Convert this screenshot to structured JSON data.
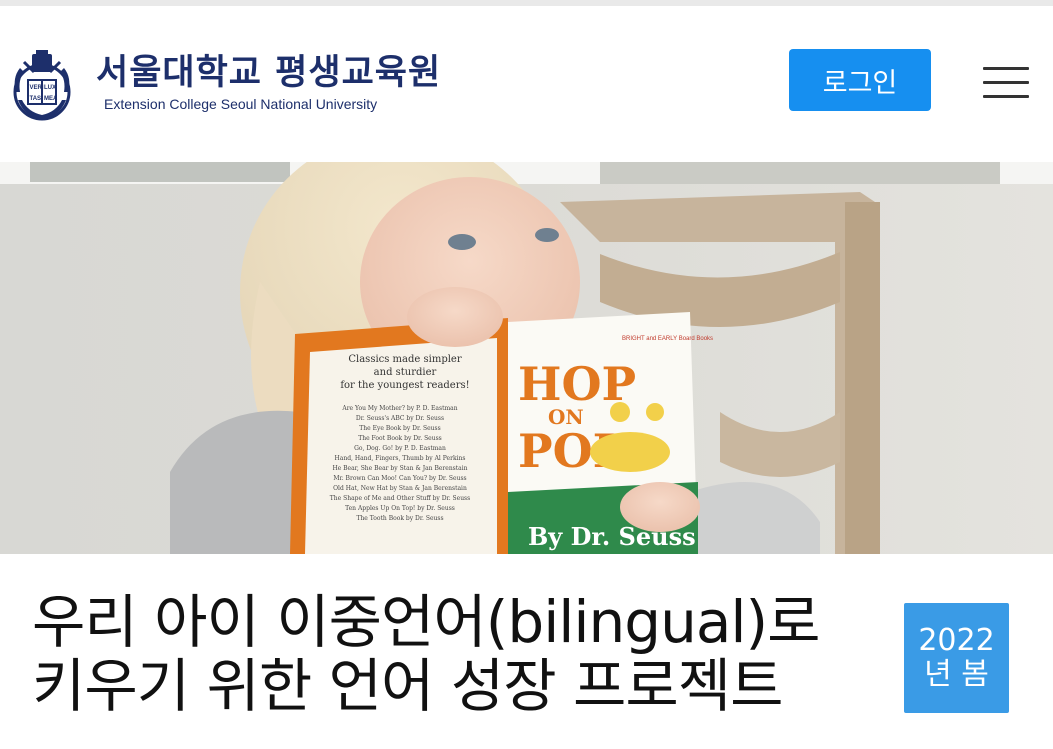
{
  "header": {
    "logo_title": "서울대학교 평생교육원",
    "logo_subtitle": "Extension College Seoul National University",
    "login_label": "로그인",
    "accent_color": "#168ff0",
    "brand_color": "#1d2f6b",
    "menu_icon": "hamburger-menu-icon",
    "emblem_text": [
      "VERI",
      "LUX",
      "TAS",
      "MEA"
    ]
  },
  "hero": {
    "book_cover_text": {
      "title_line1": "HOP",
      "title_line2": "ON",
      "title_line3": "POP",
      "author": "By Dr. Seuss",
      "series": "BRIGHT and EARLY Board Books"
    },
    "book_back_text": {
      "tagline": [
        "Classics made simpler",
        "and sturdier",
        "for the youngest readers!"
      ],
      "list": [
        "Are You My Mother? by P. D. Eastman",
        "Dr. Seuss's ABC by Dr. Seuss",
        "The Eye Book by Dr. Seuss",
        "The Foot Book by Dr. Seuss",
        "Go, Dog. Go! by P. D. Eastman",
        "Hand, Hand, Fingers, Thumb by Al Perkins",
        "He Bear, She Bear by Stan & Jan Berenstain",
        "Mr. Brown Can Moo! Can You? by Dr. Seuss",
        "Old Hat, New Hat by Stan & Jan Berenstain",
        "The Shape of Me and Other Stuff by Dr. Seuss",
        "Ten Apples Up On Top! by Dr. Seuss",
        "The Tooth Book by Dr. Seuss"
      ]
    }
  },
  "program": {
    "title_line1": "우리 아이 이중언어(bilingual)로",
    "title_line2": "키우기 위한 언어 성장 프로젝트",
    "season_year": "2022",
    "season_term": "년 봄",
    "badge_color": "#3a9be6"
  }
}
